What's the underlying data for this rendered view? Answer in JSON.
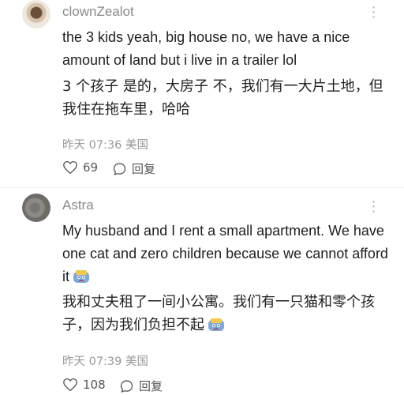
{
  "comments": [
    {
      "username": "clownZealot",
      "text_en": "the 3 kids yeah, big house no, we have a nice amount of land but i live in a trailer lol",
      "text_cn": "3 个孩子 是的，大房子 不，我们有一大片土地，但我住在拖车里，哈哈",
      "time": "昨天 07:36",
      "location": "美国",
      "likes": "69",
      "reply_label": "回复",
      "more_icon": "more-dots-icon"
    },
    {
      "username": "Astra",
      "text_en": "My husband and I rent a small apartment. We have one cat and zero children because we cannot afford it",
      "text_cn": "我和丈夫租了一间小公寓。我们有一只猫和零个孩子，因为我们负担不起",
      "time": "昨天 07:39",
      "location": "美国",
      "likes": "108",
      "reply_label": "回复",
      "more_icon": "more-dots-icon"
    }
  ]
}
